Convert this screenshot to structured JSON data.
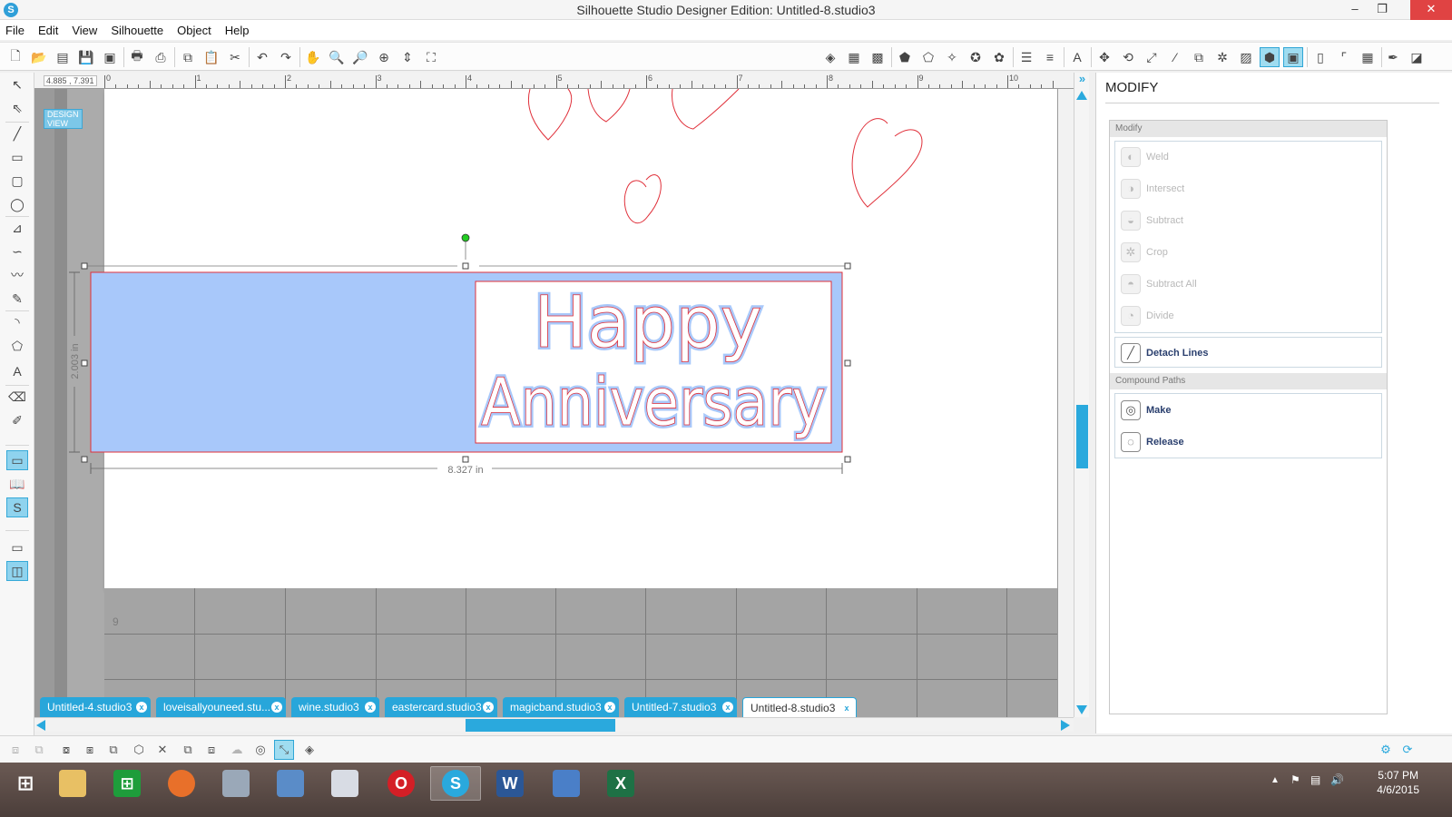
{
  "window": {
    "title": "Silhouette Studio Designer Edition: Untitled-8.studio3",
    "minimize": "–",
    "restore": "❐",
    "close": "✕"
  },
  "menu": [
    "File",
    "Edit",
    "View",
    "Silhouette",
    "Object",
    "Help"
  ],
  "canvas": {
    "coords": "4.885 , 7.391",
    "view_badge": "DESIGN VIEW",
    "ruler_numbers": [
      "0",
      "1",
      "2",
      "3",
      "4",
      "5",
      "6",
      "7",
      "8",
      "9",
      "10"
    ],
    "width_label": "8.327 in",
    "height_label": "2.003 in",
    "mat_label": "9",
    "design_text_line1": "Happy",
    "design_text_line2": "Anniversary"
  },
  "tabs": [
    {
      "label": "Untitled-4.studio3",
      "active": false
    },
    {
      "label": "loveisallyouneed.stu...",
      "active": false
    },
    {
      "label": "wine.studio3",
      "active": false
    },
    {
      "label": "eastercard.studio3",
      "active": false
    },
    {
      "label": "magicband.studio3",
      "active": false
    },
    {
      "label": "Untitled-7.studio3",
      "active": false
    },
    {
      "label": "Untitled-8.studio3",
      "active": true
    }
  ],
  "tab_close": "x",
  "panel": {
    "title": "MODIFY",
    "modify_header": "Modify",
    "modify_items": [
      {
        "label": "Weld",
        "icon": "weld-icon",
        "enabled": false
      },
      {
        "label": "Intersect",
        "icon": "intersect-icon",
        "enabled": false
      },
      {
        "label": "Subtract",
        "icon": "subtract-icon",
        "enabled": false
      },
      {
        "label": "Crop",
        "icon": "crop-icon",
        "enabled": false
      },
      {
        "label": "Subtract All",
        "icon": "subtract-all-icon",
        "enabled": false
      },
      {
        "label": "Divide",
        "icon": "divide-icon",
        "enabled": false
      }
    ],
    "detach_label": "Detach Lines",
    "compound_header": "Compound Paths",
    "make_label": "Make",
    "release_label": "Release"
  },
  "taskbar": {
    "time": "5:07 PM",
    "date": "4/6/2015"
  },
  "colors": {
    "accent": "#2aa9dd",
    "selection_fill": "#a8c8fa",
    "cut_line": "#e0303a"
  }
}
